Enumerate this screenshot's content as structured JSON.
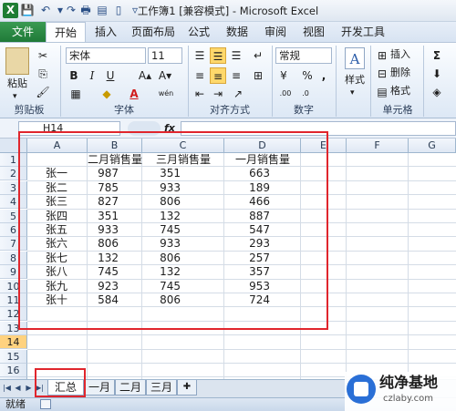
{
  "window": {
    "title": "工作簿1  [兼容模式]  -  Microsoft Excel"
  },
  "ribbon_tabs": [
    "文件",
    "开始",
    "插入",
    "页面布局",
    "公式",
    "数据",
    "审阅",
    "视图",
    "开发工具"
  ],
  "ribbon": {
    "paste_label": "粘贴",
    "font_name": "宋体",
    "font_size": "11",
    "number_format": "常规",
    "style_label": "样式",
    "insert_label": "插入",
    "delete_label": "删除",
    "format_label": "格式",
    "bold": "B",
    "italic": "I",
    "underline": "U",
    "font_color_glyph": "A",
    "style_glyph": "A",
    "wen_glyph": "wén",
    "group_labels": {
      "clipboard": "剪贴板",
      "font": "字体",
      "alignment": "对齐方式",
      "number": "数字",
      "cells": "单元格"
    }
  },
  "formula_bar": {
    "name_box": "H14",
    "fx": "fx",
    "value": ""
  },
  "columns": [
    "A",
    "B",
    "C",
    "D",
    "E",
    "F",
    "G"
  ],
  "rows": [
    "1",
    "2",
    "3",
    "4",
    "5",
    "6",
    "7",
    "8",
    "9",
    "10",
    "11",
    "12",
    "13",
    "14",
    "15",
    "16",
    "17"
  ],
  "selected_row": "14",
  "table": {
    "headers": [
      "二月销售量",
      "三月销售量",
      "一月销售量"
    ],
    "names": [
      "张一",
      "张二",
      "张三",
      "张四",
      "张五",
      "张六",
      "张七",
      "张八",
      "张九",
      "张十"
    ],
    "feb": [
      987,
      785,
      827,
      351,
      933,
      806,
      132,
      745,
      923,
      584
    ],
    "mar": [
      351,
      933,
      806,
      132,
      745,
      933,
      806,
      132,
      745,
      806
    ],
    "jan": [
      663,
      189,
      466,
      887,
      547,
      293,
      257,
      357,
      953,
      724
    ]
  },
  "sheet_tabs": [
    "汇总",
    "一月",
    "二月",
    "三月"
  ],
  "status": "就绪",
  "watermark": {
    "main": "纯净基地",
    "sub": "czlaby.com"
  },
  "colors": {
    "excel_green": "#1e7d34",
    "selection_red": "#e0262d",
    "ribbon_blue": "#dde8f5"
  }
}
